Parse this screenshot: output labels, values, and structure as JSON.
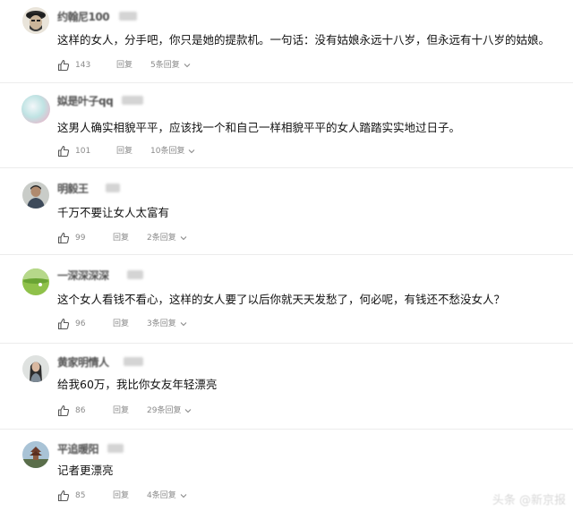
{
  "comments": [
    {
      "username": "约翰尼100",
      "avatar_icon": "bearded-man-avatar",
      "content": "这样的女人，分手吧，你只是她的提款机。一句话：没有姑娘永远十八岁，但永远有十八岁的姑娘。",
      "likes": "143",
      "reply_label": "回复",
      "replies_label": "5条回复"
    },
    {
      "username": "姒是叶子qq",
      "avatar_icon": "pastel-gradient-avatar",
      "content": "这男人确实相貌平平，应该找一个和自己一样相貌平平的女人踏踏实实地过日子。",
      "likes": "101",
      "reply_label": "回复",
      "replies_label": "10条回复"
    },
    {
      "username": "明毅王",
      "avatar_icon": "person-photo-avatar",
      "content": "千万不要让女人太富有",
      "likes": "99",
      "reply_label": "回复",
      "replies_label": "2条回复"
    },
    {
      "username": "一深深深深",
      "avatar_icon": "grass-field-avatar",
      "content": "这个女人看钱不看心，这样的女人要了以后你就天天发愁了，何必呢，有钱还不愁没女人？",
      "likes": "96",
      "reply_label": "回复",
      "replies_label": "3条回复"
    },
    {
      "username": "黄家明情人",
      "avatar_icon": "woman-photo-avatar",
      "content": "给我60万，我比你女友年轻漂亮",
      "likes": "86",
      "reply_label": "回复",
      "replies_label": "29条回复"
    },
    {
      "username": "平追暖阳",
      "avatar_icon": "pagoda-photo-avatar",
      "content": "记者更漂亮",
      "likes": "85",
      "reply_label": "回复",
      "replies_label": "4条回复"
    }
  ],
  "watermark": "头条 @新京报",
  "colors": {
    "text_primary": "#111111",
    "text_secondary": "#8a8a8a",
    "divider": "#ececec"
  }
}
